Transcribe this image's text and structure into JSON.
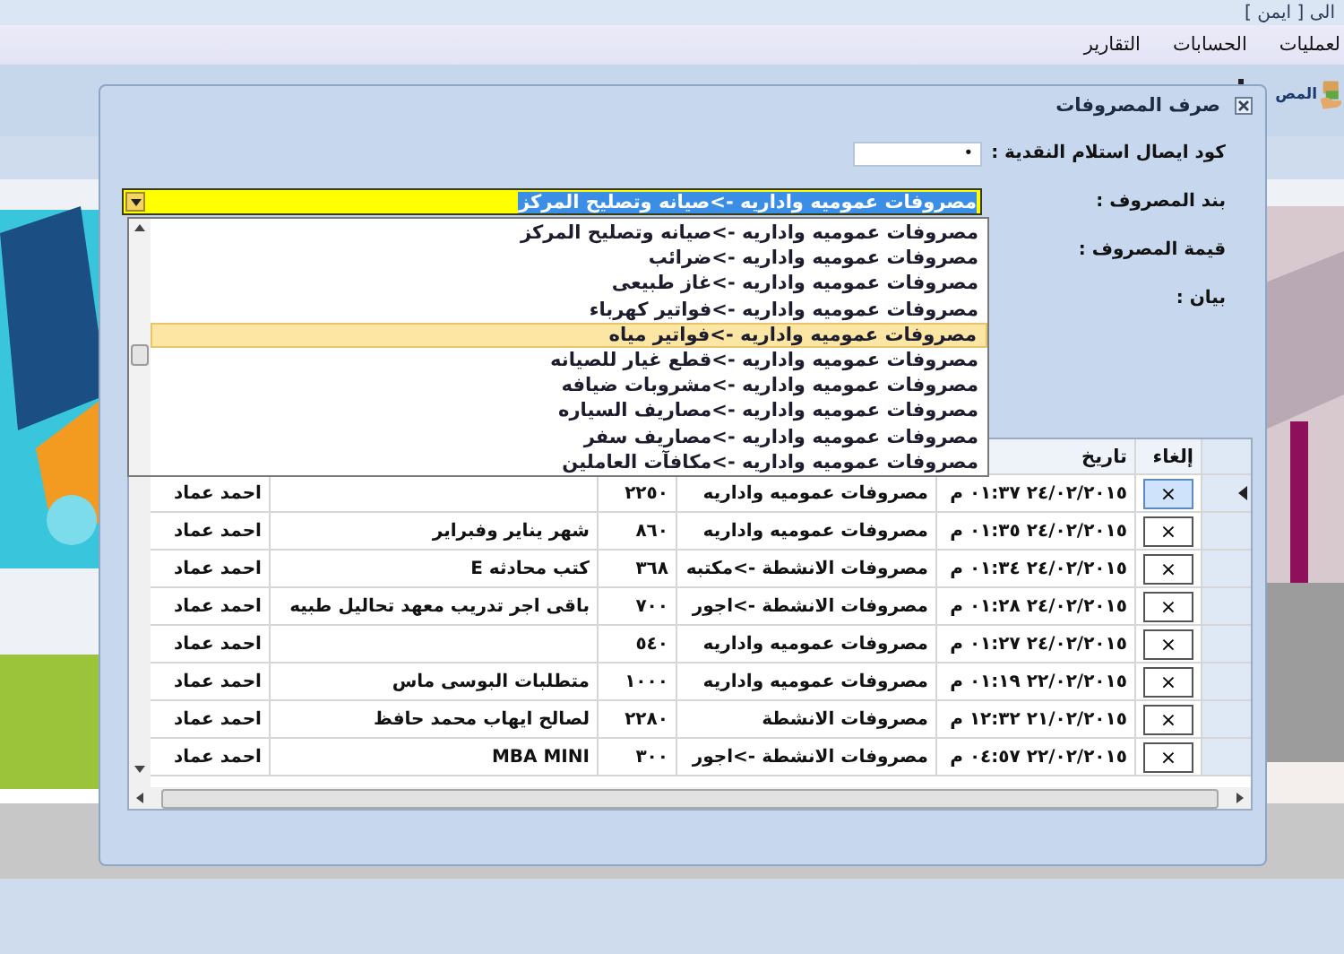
{
  "window": {
    "title": "الى [ ايمن ]"
  },
  "menu": [
    {
      "label": "لعمليات"
    },
    {
      "label": "الحسابات"
    },
    {
      "label": "التقارير"
    }
  ],
  "toolbar": {
    "items": [
      {
        "label": "المص"
      }
    ]
  },
  "dialog": {
    "title": "صرف المصروفات",
    "fields": [
      {
        "kind": "text",
        "label": "كود ايصال استلام النقدية :",
        "value": "•"
      },
      {
        "kind": "combo",
        "label": "بند المصروف :",
        "value": "مصروفات عموميه واداريه ->صيانه وتصليح المركز",
        "expanded": true
      },
      {
        "kind": "covered",
        "label": "قيمة المصروف :"
      },
      {
        "kind": "covered",
        "label": "بيان :"
      }
    ],
    "dropdown": {
      "items": [
        {
          "label": "مصروفات عموميه واداريه ->صيانه وتصليح المركز",
          "selected": false
        },
        {
          "label": "مصروفات عموميه واداريه ->ضرائب",
          "selected": false
        },
        {
          "label": "مصروفات عموميه واداريه ->غاز طبيعى",
          "selected": false
        },
        {
          "label": "مصروفات عموميه واداريه ->فواتير كهرباء",
          "selected": false
        },
        {
          "label": "مصروفات عموميه واداريه ->فواتير مياه",
          "selected": true
        },
        {
          "label": "مصروفات عموميه واداريه ->قطع غيار للصيانه",
          "selected": false
        },
        {
          "label": "مصروفات عموميه واداريه ->مشروبات ضيافه",
          "selected": false
        },
        {
          "label": "مصروفات عموميه واداريه ->مصاريف السياره",
          "selected": false
        },
        {
          "label": "مصروفات عموميه واداريه ->مصاريف سفر",
          "selected": false
        },
        {
          "label": "مصروفات عموميه واداريه ->مكافآت العاملين",
          "selected": false
        }
      ]
    },
    "table": {
      "columns": [
        "إلغاء",
        "تاريخ"
      ],
      "rows": [
        {
          "selected": true,
          "cancel": "×",
          "date": "٢٤/٠٢/٢٠١٥ ٠١:٣٧ م",
          "category": "مصروفات عموميه واداريه",
          "amount": "٢٢٥٠",
          "user": "احمد عماد"
        },
        {
          "selected": false,
          "cancel": "×",
          "date": "٢٤/٠٢/٢٠١٥ ٠١:٣٥ م",
          "category": "مصروفات عموميه واداريه",
          "amount": "٨٦٠",
          "description": "شهر يناير وفبراير",
          "user": "احمد عماد"
        },
        {
          "selected": false,
          "cancel": "×",
          "date": "٢٤/٠٢/٢٠١٥ ٠١:٣٤ م",
          "category": "مصروفات الانشطة ->مكتبه",
          "amount": "٣٦٨",
          "description": "كتب محادثه E",
          "user": "احمد عماد"
        },
        {
          "selected": false,
          "cancel": "×",
          "date": "٢٤/٠٢/٢٠١٥ ٠١:٢٨ م",
          "category": "مصروفات الانشطة ->اجور",
          "amount": "٧٠٠",
          "description": "باقى اجر تدريب معهد تحاليل طبيه",
          "user": "احمد عماد"
        },
        {
          "selected": false,
          "cancel": "×",
          "date": "٢٤/٠٢/٢٠١٥ ٠١:٢٧ م",
          "category": "مصروفات عموميه واداريه",
          "amount": "٥٤٠",
          "user": "احمد عماد"
        },
        {
          "selected": false,
          "cancel": "×",
          "date": "٢٢/٠٢/٢٠١٥ ٠١:١٩ م",
          "category": "مصروفات عموميه واداريه",
          "amount": "١٠٠٠",
          "description": "متطلبات البوسى ماس",
          "user": "احمد عماد"
        },
        {
          "selected": false,
          "cancel": "×",
          "date": "٢١/٠٢/٢٠١٥ ١٢:٣٢ م",
          "category": "مصروفات الانشطة",
          "amount": "٢٢٨٠",
          "description": "لصالح ايهاب محمد حافظ",
          "user": "احمد عماد"
        },
        {
          "selected": false,
          "cancel": "×",
          "date": "٢٢/٠٢/٢٠١٥ ٠٤:٥٧ م",
          "category": "مصروفات الانشطة ->اجور",
          "amount": "٣٠٠",
          "description": "MBA MINI",
          "user": "احمد عماد"
        }
      ]
    }
  }
}
